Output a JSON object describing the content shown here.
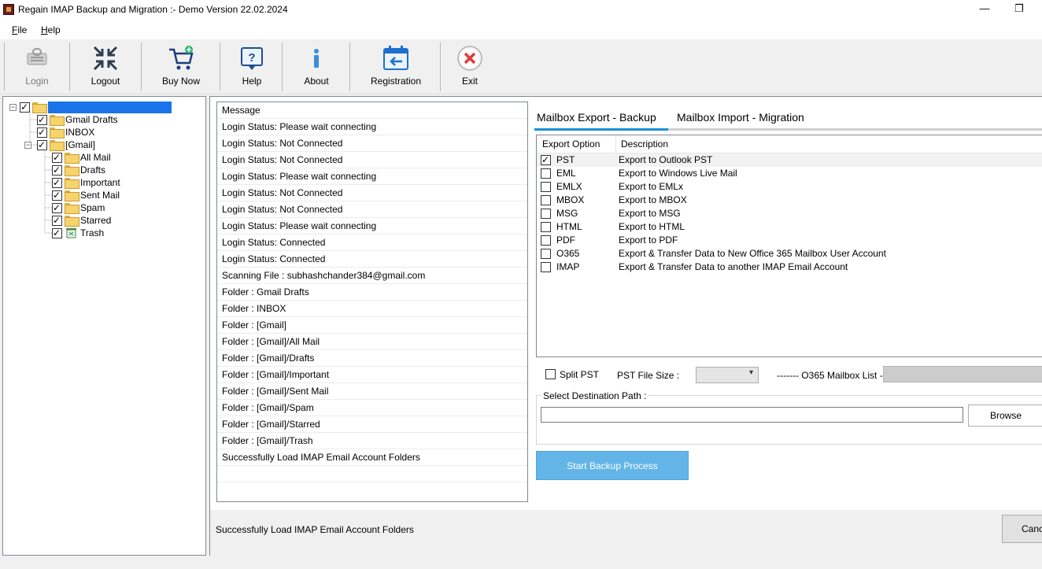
{
  "window": {
    "title": "Regain IMAP Backup and Migration :- Demo Version 22.02.2024",
    "minimize": "—",
    "restore": "❐"
  },
  "menu": [
    {
      "label": "File",
      "hotkey": "F",
      "rest": "ile"
    },
    {
      "label": "Help",
      "hotkey": "H",
      "rest": "elp"
    }
  ],
  "toolbar": {
    "login": "Login",
    "logout": "Logout",
    "buy_now": "Buy Now",
    "help": "Help",
    "about": "About",
    "registration": "Registration",
    "exit": "Exit"
  },
  "tree": {
    "root": {
      "checked": true,
      "expanded": true
    },
    "nodes": [
      {
        "label": "Gmail Drafts",
        "checked": true
      },
      {
        "label": "INBOX",
        "checked": true
      },
      {
        "label": "[Gmail]",
        "checked": true,
        "expanded": true
      }
    ],
    "gmail_children": [
      {
        "label": "All Mail",
        "checked": true,
        "icon": "folder-icon"
      },
      {
        "label": "Drafts",
        "checked": true,
        "icon": "drafts-icon"
      },
      {
        "label": "Important",
        "checked": true,
        "icon": "folder-icon"
      },
      {
        "label": "Sent Mail",
        "checked": true,
        "icon": "folder-icon"
      },
      {
        "label": "Spam",
        "checked": true,
        "icon": "folder-icon"
      },
      {
        "label": "Starred",
        "checked": true,
        "icon": "folder-icon"
      },
      {
        "label": "Trash",
        "checked": true,
        "icon": "trash-icon"
      }
    ]
  },
  "messages": {
    "header": "Message",
    "rows": [
      "Login Status: Please wait connecting",
      "Login Status: Not Connected",
      "Login Status: Not Connected",
      "Login Status: Please wait connecting",
      "Login Status: Not Connected",
      "Login Status: Not Connected",
      "Login Status: Please wait connecting",
      "Login Status: Connected",
      "Login Status: Connected",
      "Scanning File : subhashchander384@gmail.com",
      "Folder : Gmail Drafts",
      "Folder : INBOX",
      "Folder : [Gmail]",
      "Folder : [Gmail]/All Mail",
      "Folder : [Gmail]/Drafts",
      "Folder : [Gmail]/Important",
      "Folder : [Gmail]/Sent Mail",
      "Folder : [Gmail]/Spam",
      "Folder : [Gmail]/Starred",
      "Folder : [Gmail]/Trash",
      "Successfully Load IMAP Email Account Folders"
    ]
  },
  "tabs": {
    "export": "Mailbox Export - Backup",
    "import": "Mailbox Import - Migration",
    "active": "export"
  },
  "export_list": {
    "col_option": "Export Option",
    "col_description": "Description",
    "rows": [
      {
        "code": "PST",
        "description": "Export to Outlook PST",
        "checked": true
      },
      {
        "code": "EML",
        "description": "Export to Windows Live Mail",
        "checked": false
      },
      {
        "code": "EMLX",
        "description": "Export to EMLx",
        "checked": false
      },
      {
        "code": "MBOX",
        "description": "Export to MBOX",
        "checked": false
      },
      {
        "code": "MSG",
        "description": "Export to MSG",
        "checked": false
      },
      {
        "code": "HTML",
        "description": "Export to HTML",
        "checked": false
      },
      {
        "code": "PDF",
        "description": "Export to PDF",
        "checked": false
      },
      {
        "code": "O365",
        "description": "Export & Transfer Data to New Office 365 Mailbox User Account",
        "checked": false
      },
      {
        "code": "IMAP",
        "description": "Export & Transfer Data to another IMAP Email Account",
        "checked": false
      }
    ]
  },
  "options": {
    "split_pst": "Split PST",
    "split_checked": false,
    "pst_file_size": "PST File Size :",
    "pst_size_value": "",
    "o365_list": "------- O365 Mailbox List -----"
  },
  "destination": {
    "legend": "Select Destination Path :",
    "path": "",
    "browse": "Browse"
  },
  "start_button": "Start Backup Process",
  "status": {
    "text": "Successfully Load IMAP Email Account Folders",
    "cancel": "Cancel"
  },
  "colors": {
    "accent": "#1a8fd6",
    "start_button": "#63b5e8",
    "selection": "#1a73e8",
    "exit_red": "#e53935"
  }
}
